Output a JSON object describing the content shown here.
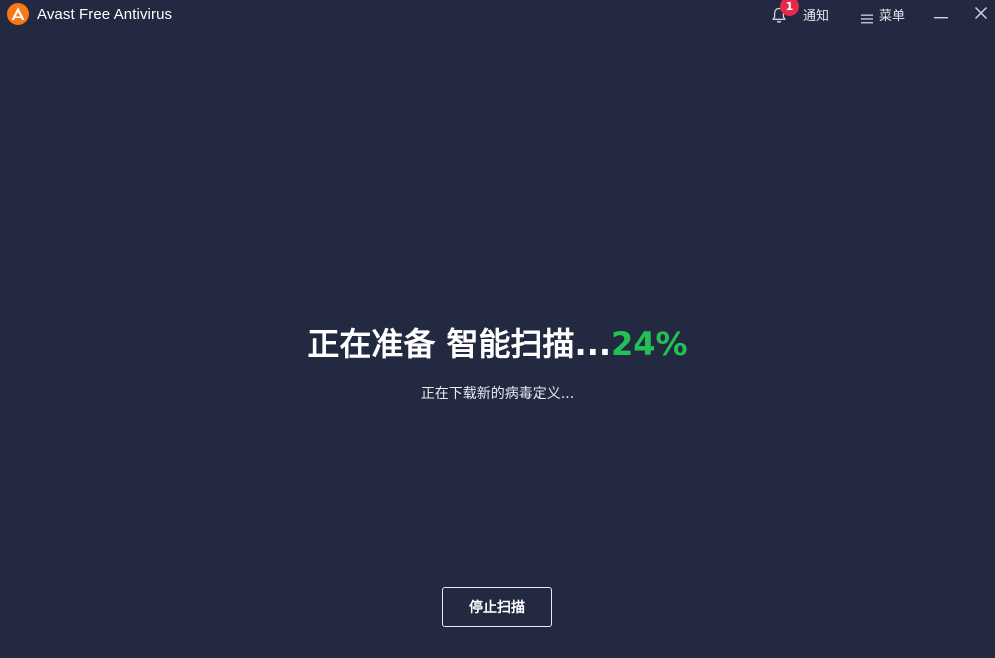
{
  "window": {
    "title": "Avast Free Antivirus",
    "logo_icon": "avast-logo-icon",
    "notifications": {
      "icon": "bell-icon",
      "count": "1",
      "label": "通知"
    },
    "menu": {
      "icon": "hamburger-icon",
      "label": "菜单"
    },
    "controls": {
      "minimize_icon": "minimize-icon",
      "close_icon": "close-icon"
    }
  },
  "scan": {
    "heading": "正在准备 智能扫描...",
    "percent": "24%",
    "progress": 0.24,
    "status": "正在下载新的病毒定义...",
    "stop_label": "停止扫描"
  },
  "colors": {
    "background": "#222940",
    "accent_green": "#21c156",
    "badge_red": "#e5294d",
    "brand_orange": "#f97816"
  }
}
